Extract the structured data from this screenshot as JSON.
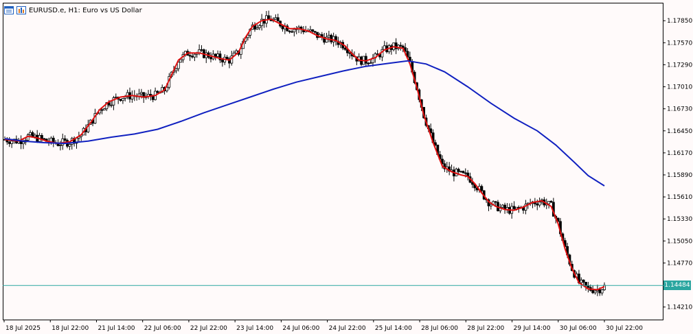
{
  "header": {
    "title": "EURUSD.e, H1:  Euro vs US Dollar",
    "icons": [
      "chart-window-icon",
      "chart-bars-icon"
    ]
  },
  "colors": {
    "background": "#fffafa",
    "candle": "#000000",
    "ma_fast": "#e01010",
    "ma_slow": "#1020c0",
    "current_price_line": "#2aa6a0"
  },
  "chart_data": {
    "type": "candlestick",
    "symbol": "EURUSD.e",
    "timeframe": "H1",
    "y_ticks": [
      "1.17850",
      "1.17570",
      "1.17290",
      "1.17010",
      "1.16730",
      "1.16450",
      "1.16170",
      "1.15890",
      "1.15610",
      "1.15330",
      "1.15050",
      "1.14770",
      "1.14210"
    ],
    "x_ticks": [
      "18 Jul 2025",
      "18 Jul 22:00",
      "21 Jul 14:00",
      "22 Jul 06:00",
      "22 Jul 22:00",
      "23 Jul 14:00",
      "24 Jul 06:00",
      "24 Jul 22:00",
      "25 Jul 14:00",
      "28 Jul 06:00",
      "28 Jul 22:00",
      "29 Jul 14:00",
      "30 Jul 06:00",
      "30 Jul 22:00"
    ],
    "ylim": [
      1.1405,
      1.1807
    ],
    "current_price": "1.14484",
    "series": [
      {
        "name": "",
        "kind": "moving-average-fast",
        "points": [
          [
            0,
            1.1634
          ],
          [
            6,
            1.1632
          ],
          [
            10,
            1.1638
          ],
          [
            14,
            1.1636
          ],
          [
            18,
            1.1632
          ],
          [
            23,
            1.1629
          ],
          [
            28,
            1.1631
          ],
          [
            33,
            1.164
          ],
          [
            37,
            1.1655
          ],
          [
            41,
            1.1672
          ],
          [
            45,
            1.1682
          ],
          [
            50,
            1.1688
          ],
          [
            55,
            1.169
          ],
          [
            60,
            1.1688
          ],
          [
            65,
            1.169
          ],
          [
            69,
            1.1697
          ],
          [
            72,
            1.1716
          ],
          [
            75,
            1.1735
          ],
          [
            79,
            1.1744
          ],
          [
            84,
            1.1744
          ],
          [
            88,
            1.1741
          ],
          [
            93,
            1.1737
          ],
          [
            97,
            1.1735
          ],
          [
            101,
            1.1745
          ],
          [
            104,
            1.1764
          ],
          [
            107,
            1.1778
          ],
          [
            111,
            1.1785
          ],
          [
            115,
            1.1787
          ],
          [
            119,
            1.1781
          ],
          [
            123,
            1.1775
          ],
          [
            127,
            1.1775
          ],
          [
            131,
            1.1772
          ],
          [
            135,
            1.1766
          ],
          [
            139,
            1.1762
          ],
          [
            143,
            1.176
          ],
          [
            147,
            1.1753
          ],
          [
            150,
            1.1743
          ],
          [
            153,
            1.1735
          ],
          [
            156,
            1.1734
          ],
          [
            160,
            1.1738
          ],
          [
            164,
            1.1748
          ],
          [
            168,
            1.1752
          ],
          [
            172,
            1.175
          ],
          [
            175,
            1.173
          ],
          [
            178,
            1.17
          ],
          [
            181,
            1.1665
          ],
          [
            185,
            1.163
          ],
          [
            189,
            1.16
          ],
          [
            193,
            1.1593
          ],
          [
            197,
            1.1589
          ],
          [
            200,
            1.1587
          ],
          [
            203,
            1.1578
          ],
          [
            206,
            1.1566
          ],
          [
            209,
            1.1555
          ],
          [
            212,
            1.1549
          ],
          [
            216,
            1.1545
          ],
          [
            220,
            1.1544
          ],
          [
            224,
            1.1548
          ],
          [
            228,
            1.1554
          ],
          [
            232,
            1.1556
          ],
          [
            236,
            1.1549
          ],
          [
            239,
            1.1527
          ],
          [
            242,
            1.1495
          ],
          [
            245,
            1.147
          ],
          [
            248,
            1.1452
          ],
          [
            252,
            1.1444
          ],
          [
            256,
            1.1443
          ],
          [
            259,
            1.1447
          ]
        ]
      },
      {
        "name": "",
        "kind": "moving-average-slow",
        "points": [
          [
            0,
            1.1635
          ],
          [
            8,
            1.1632
          ],
          [
            17,
            1.163
          ],
          [
            26,
            1.1629
          ],
          [
            36,
            1.1632
          ],
          [
            46,
            1.1637
          ],
          [
            56,
            1.1641
          ],
          [
            66,
            1.1647
          ],
          [
            76,
            1.1657
          ],
          [
            86,
            1.1668
          ],
          [
            96,
            1.1678
          ],
          [
            106,
            1.1688
          ],
          [
            116,
            1.1698
          ],
          [
            126,
            1.1707
          ],
          [
            136,
            1.1714
          ],
          [
            146,
            1.1721
          ],
          [
            156,
            1.1727
          ],
          [
            166,
            1.1731
          ],
          [
            174,
            1.1734
          ],
          [
            182,
            1.173
          ],
          [
            190,
            1.172
          ],
          [
            200,
            1.1701
          ],
          [
            210,
            1.168
          ],
          [
            220,
            1.1661
          ],
          [
            230,
            1.1645
          ],
          [
            238,
            1.1627
          ],
          [
            246,
            1.1605
          ],
          [
            252,
            1.1588
          ],
          [
            259,
            1.1575
          ]
        ]
      }
    ],
    "candle_count": 260
  }
}
